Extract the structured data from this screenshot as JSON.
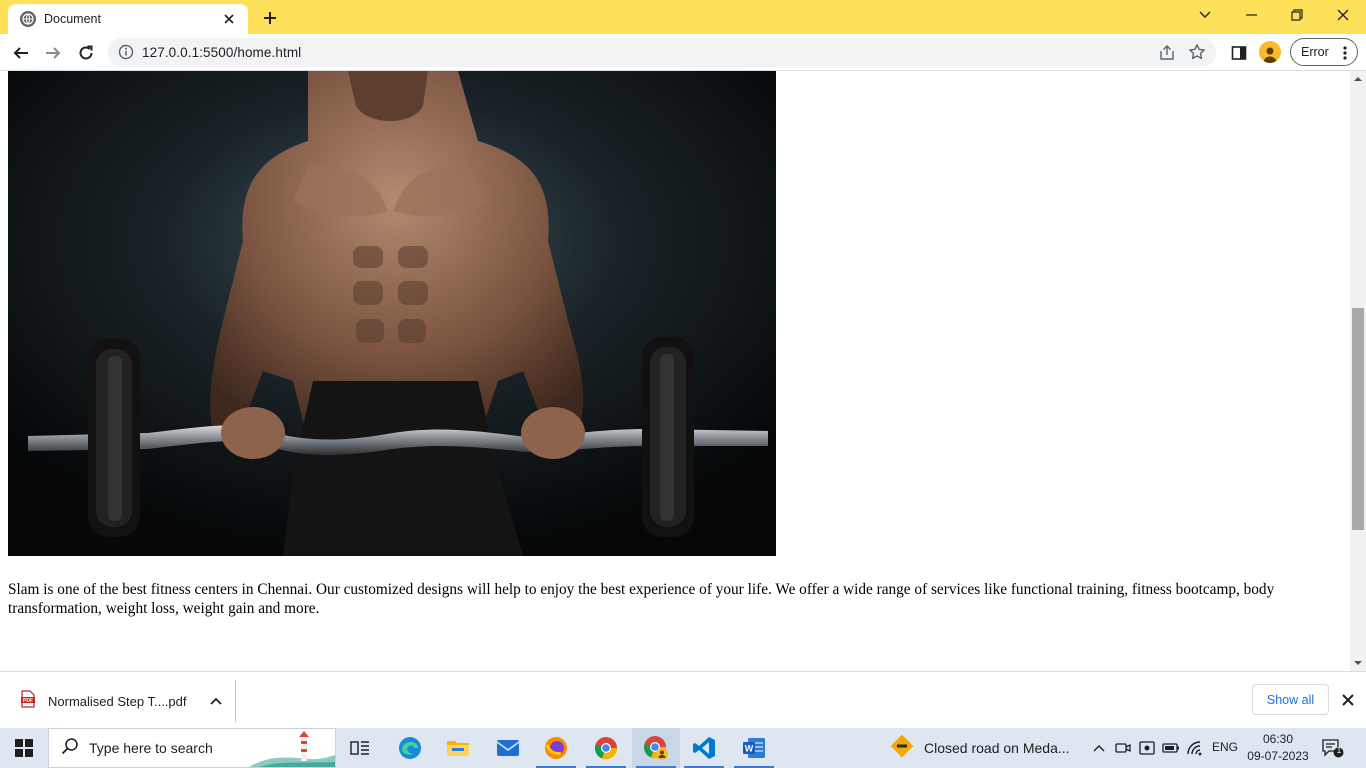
{
  "browser": {
    "tab_title": "Document",
    "url": "127.0.0.1:5500/home.html",
    "profile_status": "Error"
  },
  "page": {
    "hero_alt": "Muscular man lifting barbell",
    "description": "Slam is one of the best fitness centers in Chennai. Our customized designs will help to enjoy the best experience of your life. We offer a wide range of services like functional training, fitness bootcamp, body transformation, weight loss, weight gain and more."
  },
  "downloads": {
    "file_name": "Normalised Step T....pdf",
    "show_all_label": "Show all"
  },
  "taskbar": {
    "search_placeholder": "Type here to search",
    "news_text": "Closed road on Meda...",
    "language": "ENG",
    "time": "06:30",
    "date": "09-07-2023",
    "notification_count": "1",
    "apps": [
      "task-view",
      "edge",
      "file-explorer",
      "mail",
      "firefox",
      "chrome",
      "chrome-active",
      "vscode",
      "word"
    ]
  },
  "colors": {
    "titlebar": "#fde15a",
    "link_blue": "#1a73e8",
    "taskbar": "#dde6f1"
  }
}
